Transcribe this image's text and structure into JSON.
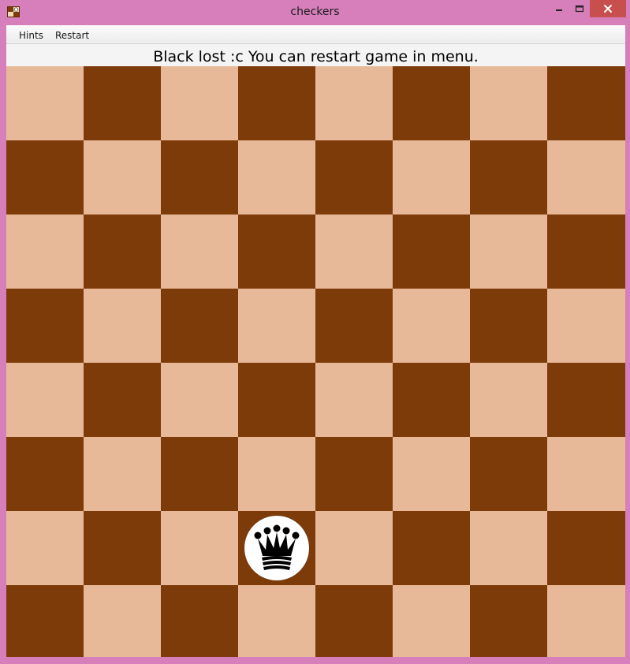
{
  "window": {
    "title": "checkers",
    "frame_color": "#d67fbb",
    "close_color": "#c7504f"
  },
  "menu": {
    "items": [
      {
        "label": "Hints"
      },
      {
        "label": "Restart"
      }
    ]
  },
  "status": {
    "message": "Black lost :c You can restart game in menu."
  },
  "board": {
    "rows": 8,
    "cols": 8,
    "light_color": "#e8b998",
    "dark_color": "#7e3b0a",
    "top_left_is_light": true,
    "pieces": [
      {
        "row": 6,
        "col": 3,
        "color": "white",
        "king": true,
        "icon": "crown-icon"
      }
    ]
  }
}
